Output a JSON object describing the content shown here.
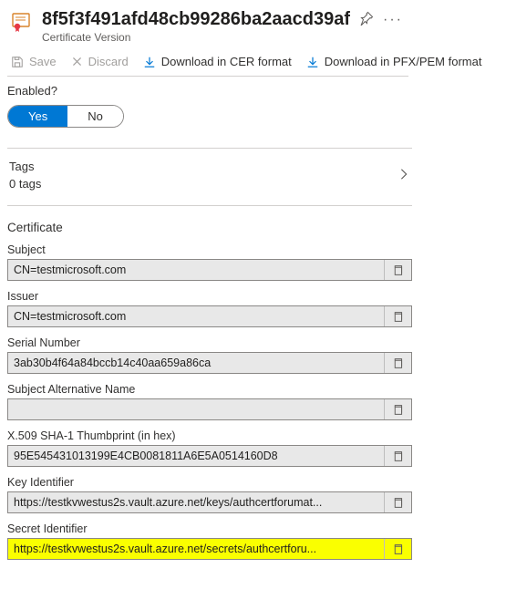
{
  "header": {
    "title": "8f5f3f491afd48cb99286ba2aacd39af",
    "subtitle": "Certificate Version"
  },
  "toolbar": {
    "save_label": "Save",
    "discard_label": "Discard",
    "download_cer_label": "Download in CER format",
    "download_pfx_label": "Download in PFX/PEM format"
  },
  "enabled": {
    "label": "Enabled?",
    "yes": "Yes",
    "no": "No",
    "value": "Yes"
  },
  "tags": {
    "label": "Tags",
    "count_text": "0 tags"
  },
  "certificate": {
    "section_label": "Certificate",
    "subject_label": "Subject",
    "subject_value": "CN=testmicrosoft.com",
    "issuer_label": "Issuer",
    "issuer_value": "CN=testmicrosoft.com",
    "serial_label": "Serial Number",
    "serial_value": "3ab30b4f64a84bccb14c40aa659a86ca",
    "san_label": "Subject Alternative Name",
    "san_value": "",
    "thumbprint_label": "X.509 SHA-1 Thumbprint (in hex)",
    "thumbprint_value": "95E545431013199E4CB0081811A6E5A0514160D8",
    "keyid_label": "Key Identifier",
    "keyid_value": "https://testkvwestus2s.vault.azure.net/keys/authcertforumat...",
    "secretid_label": "Secret Identifier",
    "secretid_value": "https://testkvwestus2s.vault.azure.net/secrets/authcertforu..."
  }
}
